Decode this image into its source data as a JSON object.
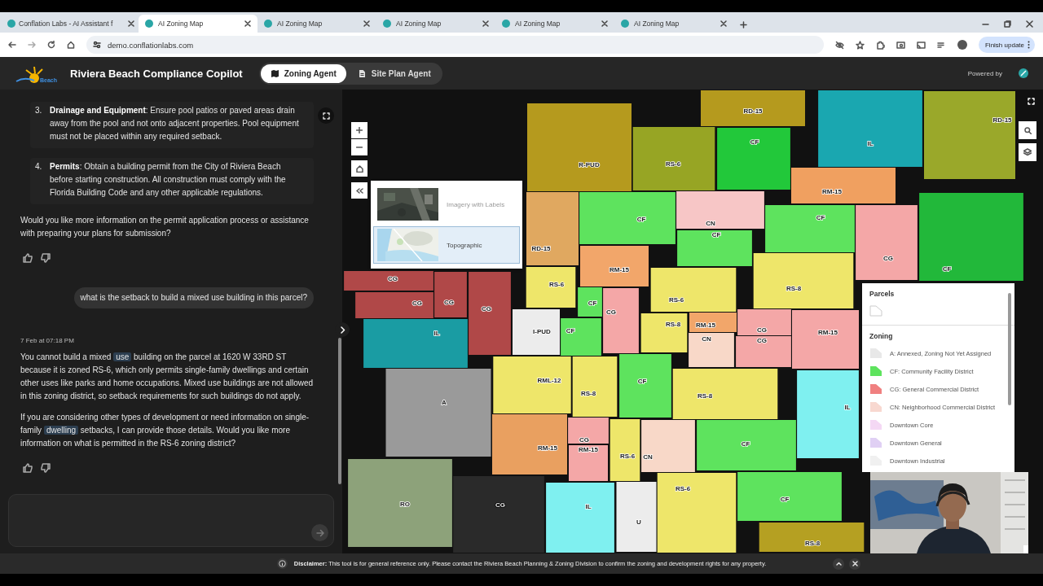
{
  "browser": {
    "tabs": [
      {
        "title": "Conflation Labs - AI Assistant f",
        "selected": false
      },
      {
        "title": "AI Zoning Map",
        "selected": true
      },
      {
        "title": "AI Zoning Map",
        "selected": false
      },
      {
        "title": "AI Zoning Map",
        "selected": false
      },
      {
        "title": "AI Zoning Map",
        "selected": false
      },
      {
        "title": "AI Zoning Map",
        "selected": false
      }
    ],
    "address": "demo.conflationlabs.com",
    "update_button": "Finish update"
  },
  "header": {
    "logo_text": "Beach",
    "title": "Riviera Beach Compliance Copilot",
    "agent_tabs": [
      {
        "label": "Zoning Agent",
        "kind": "map",
        "selected": true
      },
      {
        "label": "Site Plan Agent",
        "kind": "document",
        "selected": false
      }
    ],
    "powered_by": "Powered by"
  },
  "chat": {
    "messages": [
      {
        "kind": "list",
        "items": [
          {
            "number": "3.",
            "text": "**Drainage and Equipment**: Ensure pool patios or paved areas drain away from the pool and not onto adjacent properties. Pool equipment must not be placed within any required setback."
          },
          {
            "number": "4.",
            "text": "**Permits**: Obtain a building permit from the City of Riviera Beach before starting construction. All construction must comply with the Florida Building Code and any other applicable regulations."
          }
        ]
      },
      {
        "kind": "paragraph",
        "text": "Would you like more information on the permit application process or assistance with preparing your plans for submission?"
      },
      {
        "kind": "feedback"
      },
      {
        "kind": "user",
        "text": "what is the setback to build a mixed use building in this parcel?"
      },
      {
        "kind": "timestamp",
        "text": "7 Feb at 07:18 PM"
      },
      {
        "kind": "segments",
        "parts": [
          {
            "text": "You cannot build a mixed ",
            "highlight": false
          },
          {
            "text": "use",
            "highlight": true
          },
          {
            "text": " building on the parcel at 1620 W 33RD ST because it is zoned RS-6, which only permits single-family dwellings and certain other uses like parks and home occupations. Mixed use buildings are not allowed in this zoning district, so setback requirements for such buildings do not apply.",
            "highlight": false
          }
        ]
      },
      {
        "kind": "segments",
        "parts": [
          {
            "text": "If you are considering other types of development or need information on single-family ",
            "highlight": false
          },
          {
            "text": "dwelling",
            "highlight": true
          },
          {
            "text": " setbacks, I can provide those details. Would you like more information on what is permitted in the RS-6 zoning district?",
            "highlight": false
          }
        ]
      },
      {
        "kind": "feedback"
      }
    ]
  },
  "map": {
    "basemaps": [
      {
        "label": "Imagery with Labels",
        "kind": "imagery",
        "selected": false
      },
      {
        "label": "Topographic",
        "kind": "topo",
        "selected": true
      }
    ],
    "zones": [
      {
        "label": "RD-15",
        "color": "#b59a1e"
      },
      {
        "label": "RS-6",
        "color": "#97a524"
      },
      {
        "label": "R-PUD",
        "color": "#b59a1e"
      },
      {
        "label": "CF",
        "color": "#22c83a"
      },
      {
        "label": "IL",
        "color": "#1aa7b0"
      },
      {
        "label": "RD-15",
        "color": "#9aa82a"
      },
      {
        "label": "RM-15",
        "color": "#f0a060"
      },
      {
        "label": "CF",
        "color": "#5ee35e"
      },
      {
        "label": "CF",
        "color": "#5ee35e"
      },
      {
        "label": "CN",
        "color": "#f7c6c6"
      },
      {
        "label": "CF",
        "color": "#5ee35e"
      },
      {
        "label": "RM-15",
        "color": "#f2a66a"
      },
      {
        "label": "RD-15",
        "color": "#e0a860"
      },
      {
        "label": "RS-6",
        "color": "#eee66a"
      },
      {
        "label": "CF",
        "color": "#5ee35e"
      },
      {
        "label": "CG",
        "color": "#f4a7a7"
      },
      {
        "label": "RS-6",
        "color": "#eee66a"
      },
      {
        "label": "RS-8",
        "color": "#eee66a"
      },
      {
        "label": "RM-15",
        "color": "#f2a66a"
      },
      {
        "label": "CN",
        "color": "#f8d8c8"
      },
      {
        "label": "CG",
        "color": "#f4a7a7"
      },
      {
        "label": "CG",
        "color": "#f4a7a7"
      },
      {
        "label": "RM-15",
        "color": "#f4a7a7"
      },
      {
        "label": "RS-8",
        "color": "#eee66a"
      },
      {
        "label": "CG",
        "color": "#f4a7a7"
      },
      {
        "label": "CF",
        "color": "#22b83a"
      },
      {
        "label": "CG",
        "color": "#b04848"
      },
      {
        "label": "CG",
        "color": "#b04848"
      },
      {
        "label": "CG",
        "color": "#b04848"
      },
      {
        "label": "CG",
        "color": "#b04848"
      },
      {
        "label": "IL",
        "color": "#1a9ca3"
      },
      {
        "label": "I-PUD",
        "color": "#ececec"
      },
      {
        "label": "CF",
        "color": "#5ee35e"
      },
      {
        "label": "A",
        "color": "#9a9a9a"
      },
      {
        "label": "RO",
        "color": "#8da27a"
      },
      {
        "label": "CG",
        "color": "#2a2a2a"
      },
      {
        "label": "RML-12",
        "color": "#eee66a"
      },
      {
        "label": "RS-8",
        "color": "#eee66a"
      },
      {
        "label": "CF",
        "color": "#5ee35e"
      },
      {
        "label": "RS-8",
        "color": "#eee66a"
      },
      {
        "label": "IL",
        "color": "#7ff0f0"
      },
      {
        "label": "CF",
        "color": "#5ee35e"
      },
      {
        "label": "CG",
        "color": "#f4a7a7"
      },
      {
        "label": "RM-15",
        "color": "#e9a060"
      },
      {
        "label": "RM-15",
        "color": "#f4a7a7"
      },
      {
        "label": "RS-6",
        "color": "#eee66a"
      },
      {
        "label": "CN",
        "color": "#f8d8c8"
      },
      {
        "label": "RS-6",
        "color": "#eee66a"
      },
      {
        "label": "IL",
        "color": "#7ff0f0"
      },
      {
        "label": "U",
        "color": "#ececec"
      },
      {
        "label": "CF",
        "color": "#5ee35e"
      },
      {
        "label": "RS-8",
        "color": "#b5a022"
      }
    ],
    "legend": {
      "parcels_title": "Parcels",
      "zoning_title": "Zoning",
      "zoning_items": [
        {
          "label": "A: Annexed, Zoning Not Yet Assigned",
          "color": "#e8e8e8"
        },
        {
          "label": "CF: Community Facility District",
          "color": "#5ee35e"
        },
        {
          "label": "CG: General Commercial District",
          "color": "#f08080"
        },
        {
          "label": "CN: Neighborhood Commercial District",
          "color": "#f8d8d0"
        },
        {
          "label": "Downtown Core",
          "color": "#f4d8f4"
        },
        {
          "label": "Downtown General",
          "color": "#e0d0f4"
        },
        {
          "label": "Downtown Industrial",
          "color": "#f0f0f0"
        }
      ]
    }
  },
  "disclaimer": "**Disclaimer:** This tool is for general reference only. Please contact the Riviera Beach Planning & Zoning Division to confirm the zoning and development rights for any property."
}
